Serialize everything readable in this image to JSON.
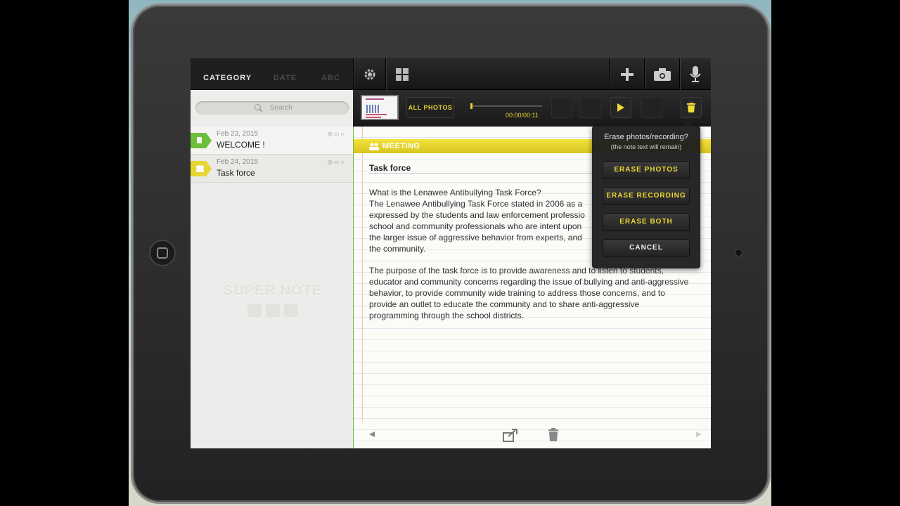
{
  "sidebar": {
    "tabs": {
      "category": "CATEGORY",
      "date": "DATE",
      "abc": "ABC"
    },
    "search_placeholder": "Search",
    "notes": [
      {
        "date": "Feb 23, 2015",
        "title": "WELCOME !",
        "tag_color": "#6cbf3a"
      },
      {
        "date": "Feb 24, 2015",
        "title": "Task force",
        "tag_color": "#e6d533"
      }
    ],
    "watermark": "SUPER NOTE"
  },
  "media": {
    "all_photos_label": "ALL PHOTOS",
    "time": "00:00/00:11",
    "progress": 0.0
  },
  "note": {
    "category": "MEETING",
    "title": "Task force",
    "body": [
      "What is the Lenawee Antibullying Task Force?\nThe Lenawee Antibullying Task Force stated in 2006 as a\nexpressed by the students and law enforcement professio\nschool and community professionals who are intent upon\nthe larger issue of aggressive behavior from experts, and\nthe community.",
      "The purpose of the task force is to provide awareness and to listen to students,\neducator and community concerns regarding the issue of bullying and anti-aggressive\nbehavior, to provide community wide training to address those concerns, and to\nprovide an outlet to educate the community and to share anti-aggressive\nprogramming through the school districts."
    ]
  },
  "popover": {
    "question": "Erase photos/recording?",
    "subtitle": "(the note text will remain)",
    "erase_photos": "ERASE PHOTOS",
    "erase_recording": "ERASE RECORDING",
    "erase_both": "ERASE BOTH",
    "cancel": "CANCEL"
  },
  "colors": {
    "accent": "#e6d533",
    "green_tag": "#6cbf3a",
    "dark_bar": "#1e1e1e"
  }
}
